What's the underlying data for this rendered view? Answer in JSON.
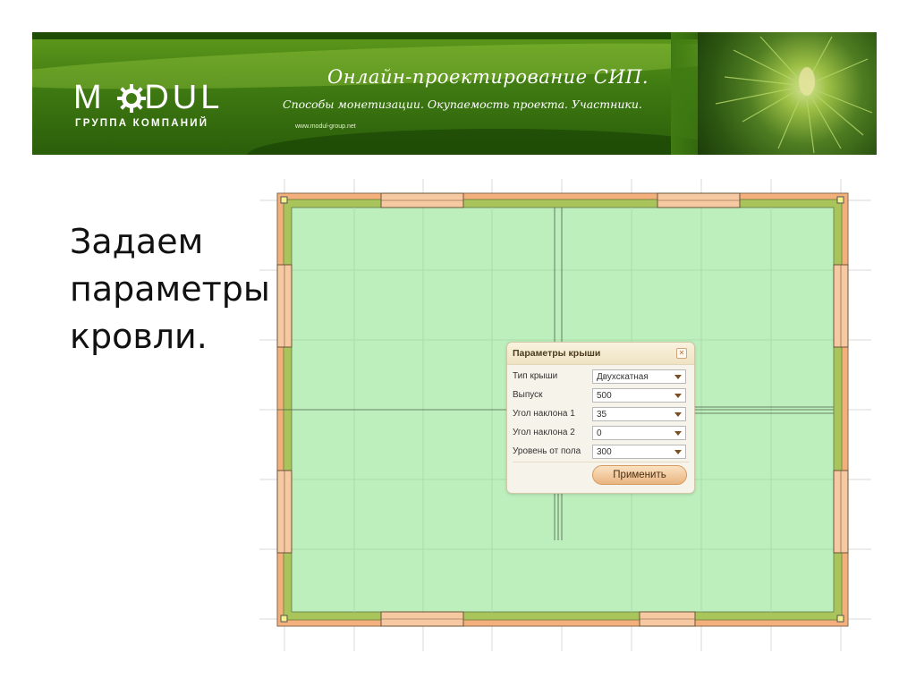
{
  "banner": {
    "logo_text": "MODUL",
    "logo_subtitle": "ГРУППА КОМПАНИЙ",
    "title": "Онлайн-проектирование СИП.",
    "subtitle": "Способы монетизации. Окупаемость проекта. Участники.",
    "url": "www.modul-group.net"
  },
  "slide_text": {
    "line1": "Задаем",
    "line2": "параметры",
    "line3": "кровли."
  },
  "dialog": {
    "title": "Параметры крыши",
    "close_icon": "close-icon",
    "fields": [
      {
        "label": "Тип крыши",
        "value": "Двухскатная"
      },
      {
        "label": "Выпуск",
        "value": "500"
      },
      {
        "label": "Угол наклона 1",
        "value": "35"
      },
      {
        "label": "Угол наклона 2",
        "value": "0"
      },
      {
        "label": "Уровень от пола",
        "value": "300"
      }
    ],
    "apply_label": "Применить"
  },
  "colors": {
    "floor": "#bdefbd",
    "wall_outer": "#f4b07c",
    "wall_inner": "#a8c45a",
    "grid": "#d8d8d8"
  }
}
